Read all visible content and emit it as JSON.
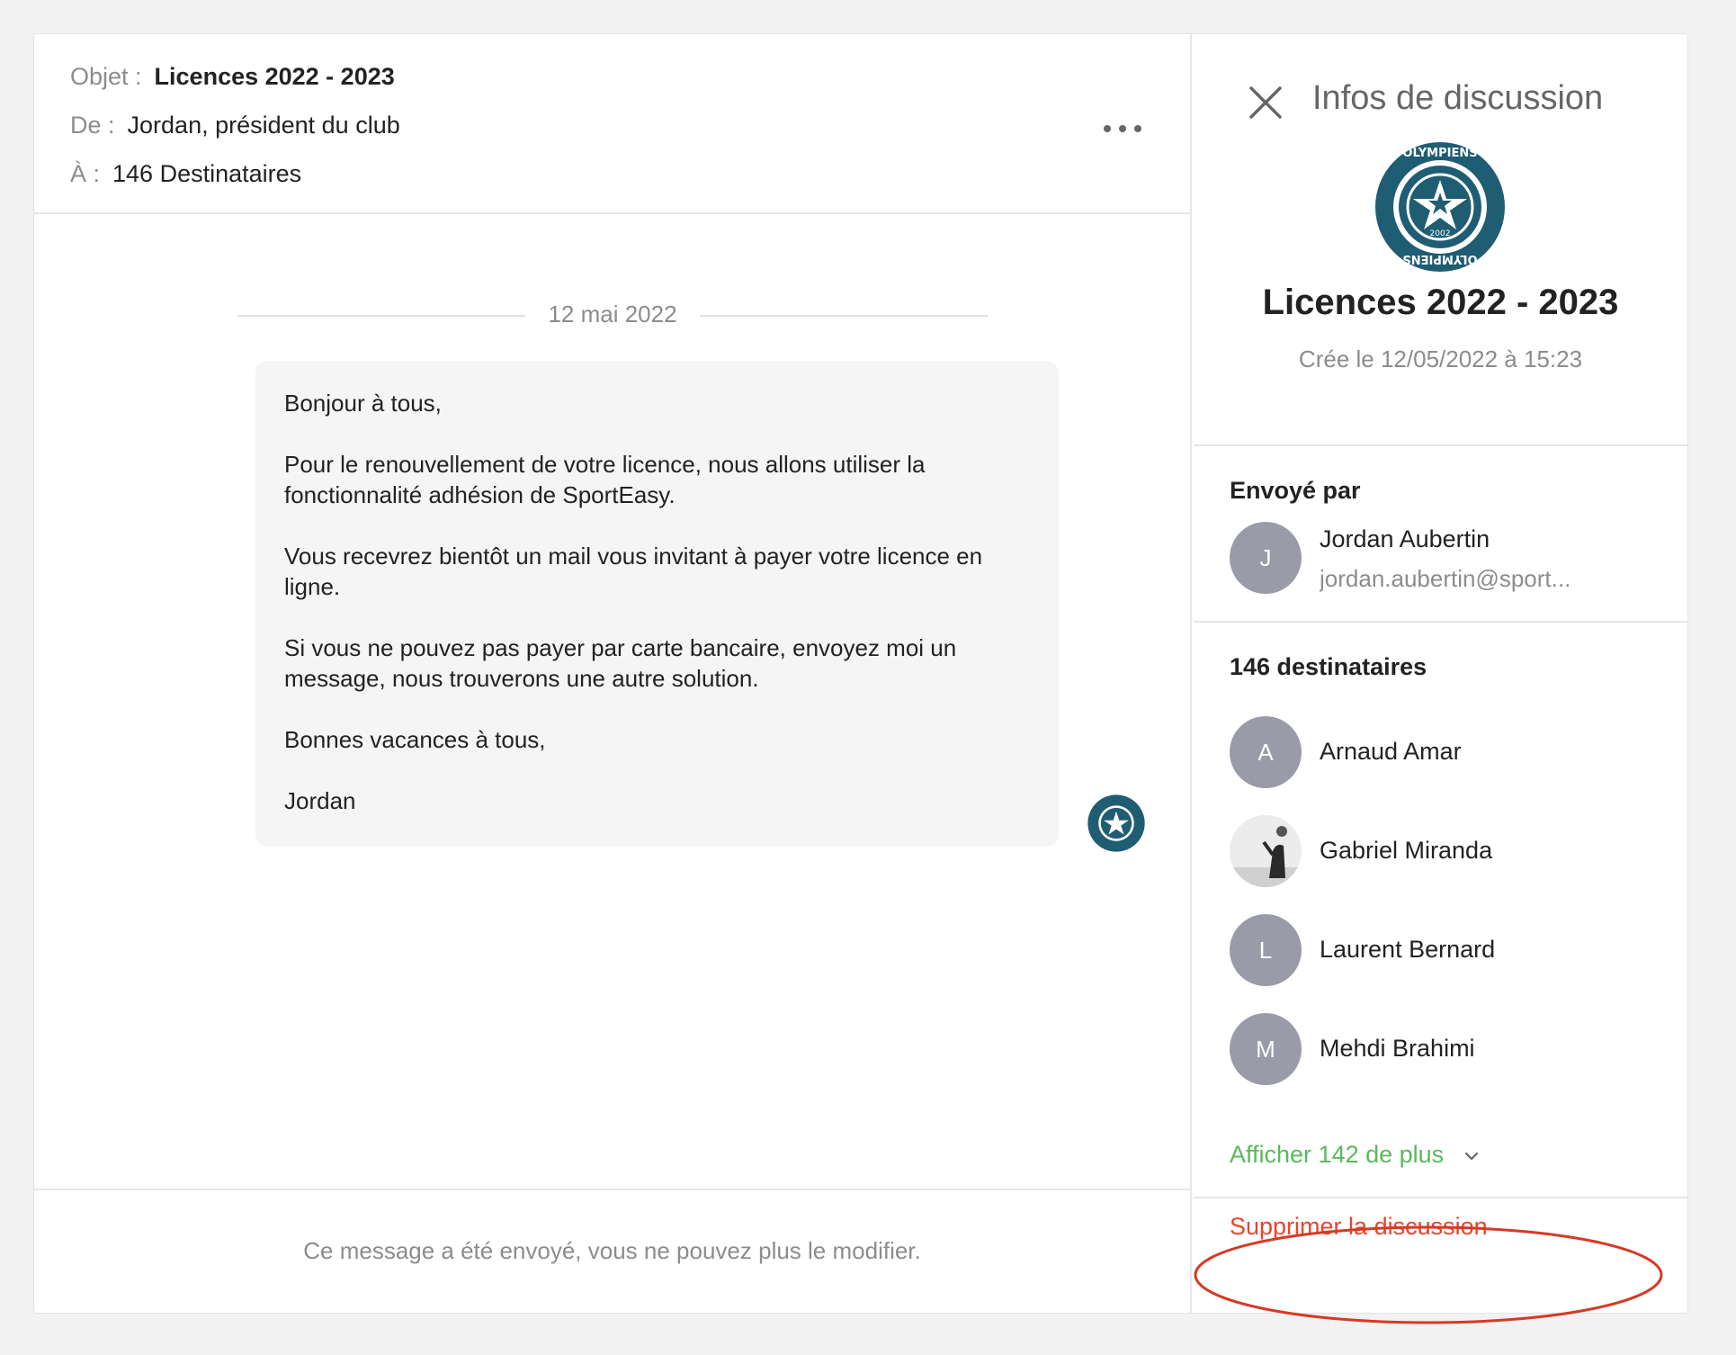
{
  "header": {
    "subject_label": "Objet :",
    "subject": "Licences 2022 - 2023",
    "from_label": "De :",
    "from": "Jordan, président du club",
    "to_label": "À :",
    "to": "146 Destinataires",
    "more_icon": "more-horizontal-icon"
  },
  "thread": {
    "date": "12 mai 2022",
    "message": [
      "Bonjour à tous,",
      "Pour le renouvellement de votre licence, nous allons utiliser la fonctionnalité adhésion de SportEasy.",
      "Vous recevrez bientôt un mail vous invitant à payer votre licence en ligne.",
      "Si vous ne pouvez pas payer par carte bancaire, envoyez moi un message, nous trouverons une autre solution.",
      "Bonnes vacances à tous,",
      "Jordan"
    ],
    "footer_note": "Ce message a été envoyé, vous ne pouvez plus le modifier."
  },
  "panel": {
    "title": "Infos de discussion",
    "close_icon": "close-icon",
    "club_logo": {
      "text_top": "OLYMPIENS",
      "text_bottom": "OLYMPIENS",
      "year": "2002"
    },
    "discussion_title": "Licences 2022 - 2023",
    "created": "Crée le 12/05/2022 à 15:23",
    "sent_by_title": "Envoyé par",
    "sender": {
      "initial": "J",
      "name": "Jordan Aubertin",
      "email": "jordan.aubertin@sport..."
    },
    "recipients_title": "146 destinataires",
    "recipients": [
      {
        "initial": "A",
        "name": "Arnaud Amar"
      },
      {
        "initial": "",
        "name": "Gabriel Miranda"
      },
      {
        "initial": "L",
        "name": "Laurent Bernard"
      },
      {
        "initial": "M",
        "name": "Mehdi Brahimi"
      }
    ],
    "show_more": "Afficher 142 de plus",
    "delete": "Supprimer la discussion"
  },
  "colors": {
    "accent_green": "#5cb85c",
    "danger_red": "#e8452c",
    "avatar_gray": "#9a9ba8",
    "logo_teal": "#1f5d73"
  }
}
